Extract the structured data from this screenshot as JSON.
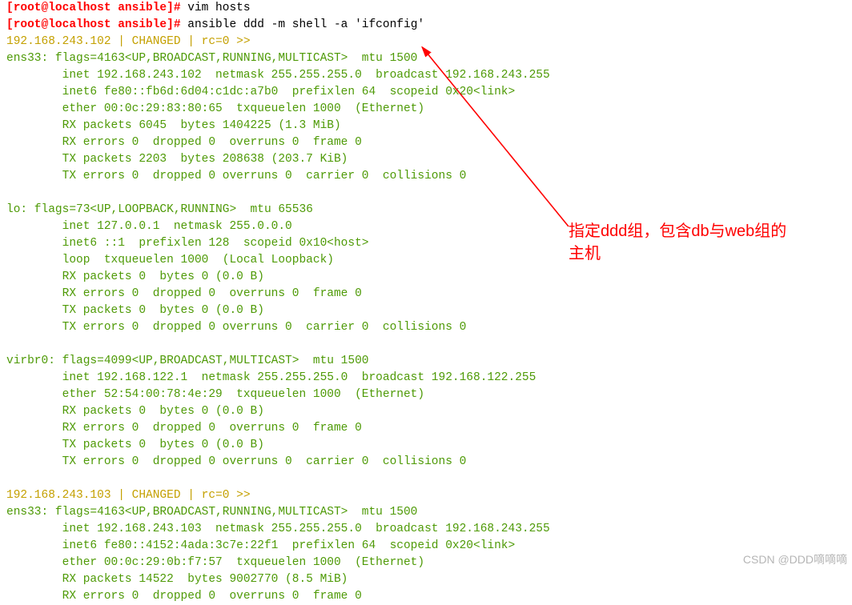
{
  "line0": {
    "prompt": "[root@localhost ansible]#",
    "cmd": " vim hosts"
  },
  "line1": {
    "prompt": "[root@localhost ansible]#",
    "cmd": " ansible ddd -m shell -a 'ifconfig'"
  },
  "out": [
    "192.168.243.102 | CHANGED | rc=0 >>",
    "ens33: flags=4163<UP,BROADCAST,RUNNING,MULTICAST>  mtu 1500",
    "        inet 192.168.243.102  netmask 255.255.255.0  broadcast 192.168.243.255",
    "        inet6 fe80::fb6d:6d04:c1dc:a7b0  prefixlen 64  scopeid 0x20<link>",
    "        ether 00:0c:29:83:80:65  txqueuelen 1000  (Ethernet)",
    "        RX packets 6045  bytes 1404225 (1.3 MiB)",
    "        RX errors 0  dropped 0  overruns 0  frame 0",
    "        TX packets 2203  bytes 208638 (203.7 KiB)",
    "        TX errors 0  dropped 0 overruns 0  carrier 0  collisions 0",
    "",
    "lo: flags=73<UP,LOOPBACK,RUNNING>  mtu 65536",
    "        inet 127.0.0.1  netmask 255.0.0.0",
    "        inet6 ::1  prefixlen 128  scopeid 0x10<host>",
    "        loop  txqueuelen 1000  (Local Loopback)",
    "        RX packets 0  bytes 0 (0.0 B)",
    "        RX errors 0  dropped 0  overruns 0  frame 0",
    "        TX packets 0  bytes 0 (0.0 B)",
    "        TX errors 0  dropped 0 overruns 0  carrier 0  collisions 0",
    "",
    "virbr0: flags=4099<UP,BROADCAST,MULTICAST>  mtu 1500",
    "        inet 192.168.122.1  netmask 255.255.255.0  broadcast 192.168.122.255",
    "        ether 52:54:00:78:4e:29  txqueuelen 1000  (Ethernet)",
    "        RX packets 0  bytes 0 (0.0 B)",
    "        RX errors 0  dropped 0  overruns 0  frame 0",
    "        TX packets 0  bytes 0 (0.0 B)",
    "        TX errors 0  dropped 0 overruns 0  carrier 0  collisions 0",
    "",
    "192.168.243.103 | CHANGED | rc=0 >>",
    "ens33: flags=4163<UP,BROADCAST,RUNNING,MULTICAST>  mtu 1500",
    "        inet 192.168.243.103  netmask 255.255.255.0  broadcast 192.168.243.255",
    "        inet6 fe80::4152:4ada:3c7e:22f1  prefixlen 64  scopeid 0x20<link>",
    "        ether 00:0c:29:0b:f7:57  txqueuelen 1000  (Ethernet)",
    "        RX packets 14522  bytes 9002770 (8.5 MiB)",
    "        RX errors 0  dropped 0  overruns 0  frame 0"
  ],
  "annotation": {
    "line1": "指定ddd组，包含db与web组的",
    "line2": "主机"
  },
  "watermark": "CSDN @DDD嘀嘀嘀"
}
